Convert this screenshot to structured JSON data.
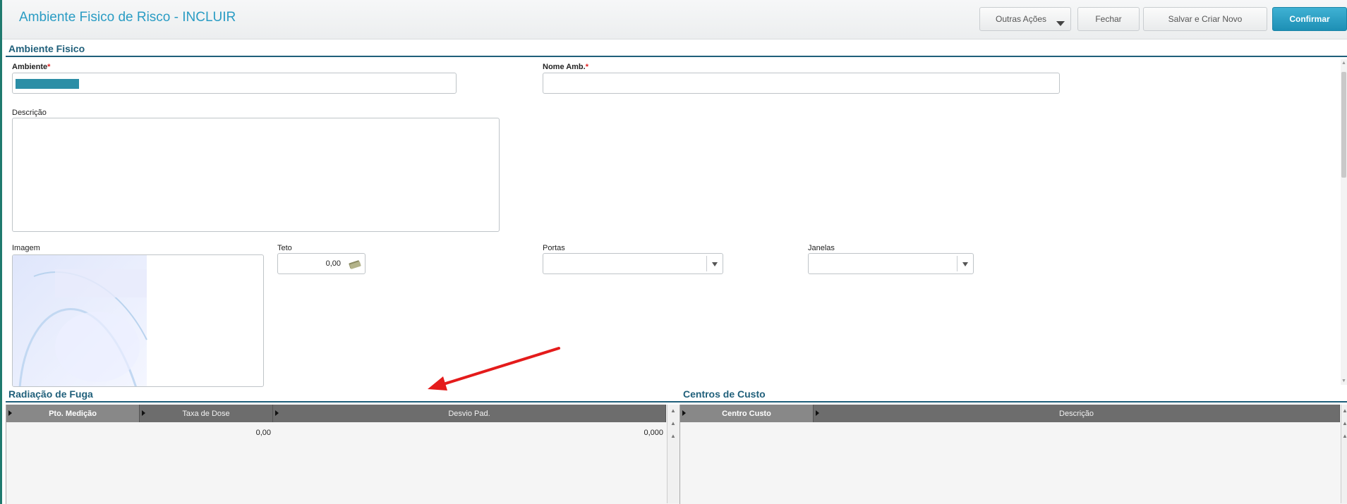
{
  "header": {
    "title": "Ambiente Fisico de Risco - INCLUIR",
    "buttons": {
      "outras": "Outras Ações",
      "fechar": "Fechar",
      "salvar": "Salvar e Criar Novo",
      "confirmar": "Confirmar"
    }
  },
  "section_main": {
    "title": "Ambiente Fisico"
  },
  "fields": {
    "ambiente": {
      "label": "Ambiente",
      "required_mark": "*"
    },
    "nome_amb": {
      "label": "Nome Amb.",
      "required_mark": "*"
    },
    "descricao": {
      "label": "Descrição"
    },
    "imagem": {
      "label": "Imagem"
    },
    "teto": {
      "label": "Teto",
      "value": "0,00"
    },
    "portas": {
      "label": "Portas"
    },
    "janelas": {
      "label": "Janelas"
    }
  },
  "grid_radiacao": {
    "title": "Radiação de Fuga",
    "columns": [
      "Pto. Medição",
      "Taxa de Dose",
      "Desvio Pad."
    ],
    "rows": [
      {
        "taxa": "0,00",
        "desvio": "0,000"
      }
    ]
  },
  "grid_centros": {
    "title": "Centros de Custo",
    "columns": [
      "Centro Custo",
      "Descrição"
    ]
  },
  "colors": {
    "title": "#2a9cc4",
    "confirm_button": "#1d8fb5",
    "section": "#1f5f7a",
    "annotation_arrow": "#e41b1b"
  }
}
